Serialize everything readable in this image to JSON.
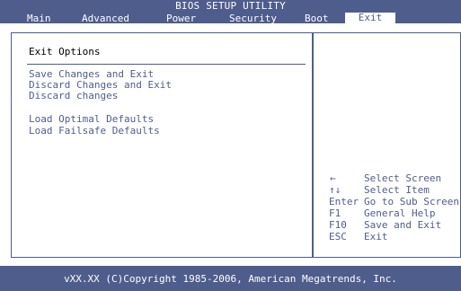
{
  "header": {
    "title": "BIOS SETUP UTILITY",
    "tabs": [
      {
        "label": "Main"
      },
      {
        "label": "Advanced"
      },
      {
        "label": "Power"
      },
      {
        "label": "Security"
      },
      {
        "label": "Boot"
      },
      {
        "label": "Exit",
        "active": true
      }
    ]
  },
  "main": {
    "section_title": "Exit Options",
    "options": [
      {
        "label": "Save Changes and Exit"
      },
      {
        "label": "Discard Changes and Exit"
      },
      {
        "label": "Discard changes"
      },
      {
        "label": "Load Optimal Defaults"
      },
      {
        "label": "Load Failsafe Defaults"
      }
    ]
  },
  "help": {
    "rows": [
      {
        "key": "←",
        "desc": "Select Screen"
      },
      {
        "key": "↑↓",
        "desc": "Select Item"
      },
      {
        "key": "Enter",
        "desc": "Go to Sub Screen"
      },
      {
        "key": "F1",
        "desc": "General Help"
      },
      {
        "key": "F10",
        "desc": "Save and Exit"
      },
      {
        "key": "ESC",
        "desc": "Exit"
      }
    ]
  },
  "footer": {
    "text": "vXX.XX (C)Copyright 1985-2006, American Megatrends, Inc."
  },
  "colors": {
    "accent": "#4f5d8d",
    "background": "#ffffff",
    "text": "#000000"
  }
}
